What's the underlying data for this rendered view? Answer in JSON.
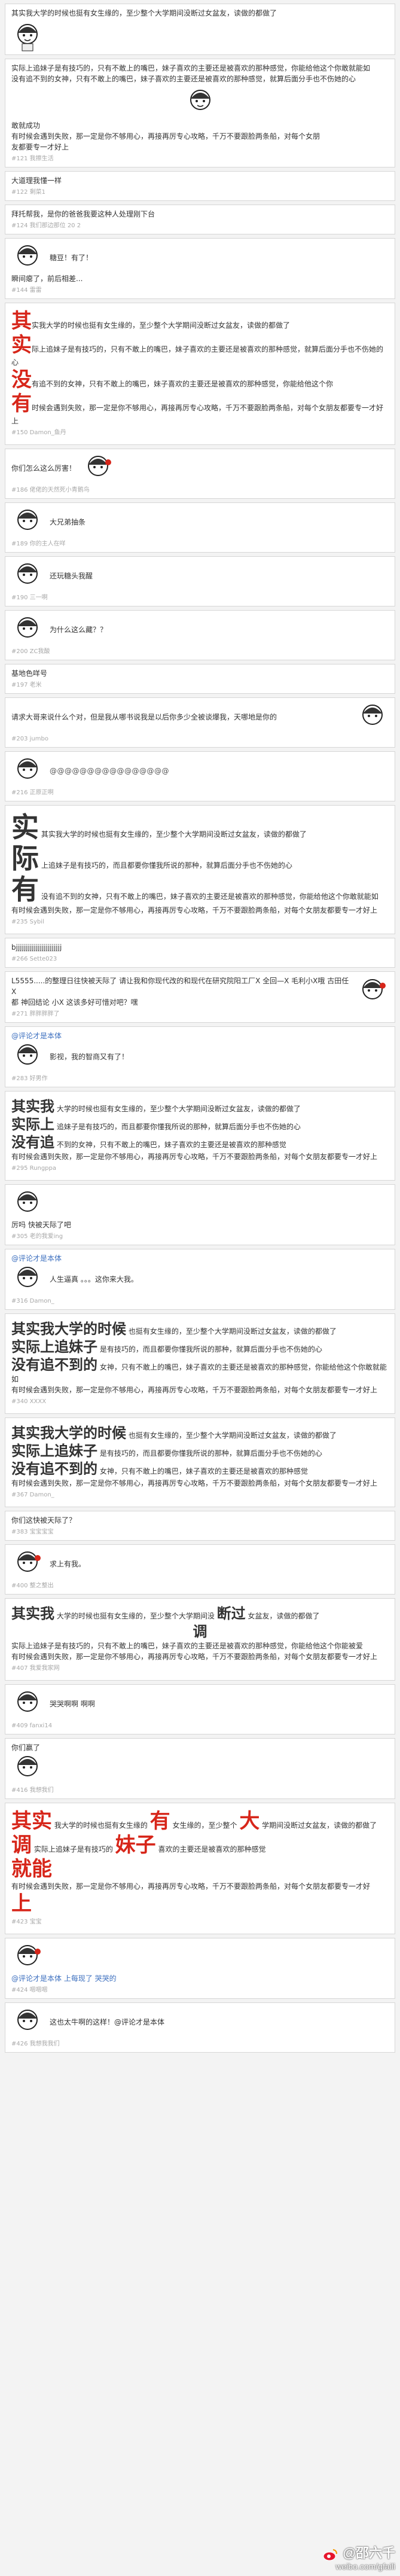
{
  "posts": [
    {
      "text": "其实我大学的时候也挺有女生缘的，至少整个大学期间没断过女盆友，读做的都做了",
      "meta": ""
    },
    {
      "text": "实际上追妹子是有技巧的，只有不敢上的嘴巴，妹子喜欢的主要还是被喜欢的那种感觉，你能给他这个你敢就能如",
      "meta": ""
    },
    {
      "text": "没有追不到的女神，只有不敢上的嘴巴，妹子喜欢的主要还是被喜欢的那种感觉，就算后面分手也不伤她的心",
      "meta": ""
    },
    {
      "text": "敢就成功",
      "meta": ""
    },
    {
      "text": "有时候会遇到失败，那一定是你不够用心，再接再厉专心攻略，千万不要跟脸两条船，对每个女朋",
      "meta": ""
    },
    {
      "text": "友都要专一才好上",
      "meta": "#121 我擦生活"
    },
    {
      "text": "大道理我懂一样",
      "meta": "#122 剩菜1"
    },
    {
      "text": "拜托帮我，是你的爸爸我要这种人处理刚下台",
      "meta": "#124 我们那边那位 20 2"
    },
    {
      "text": "糖豆！有了！",
      "meta": ""
    },
    {
      "text": "瞬间瘪了，前后相差...",
      "meta": "#144 雷雷"
    },
    {
      "big1": "其",
      "text1": "实我大学的时候也挺有女生缘的，至少整个大学期间没断过女盆友，读做的都做了",
      "big2": "实",
      "text2": "际上追妹子是有技巧的，只有不敢上的嘴巴，妹子喜欢的主要还是被喜欢的那种感觉，就算后面分手也不伤她的心",
      "big3": "没",
      "text3": "有追不到的女神，只有不敢上的嘴巴，妹子喜欢的主要还是被喜欢的那种感觉，你能给他这个你",
      "big4": "有",
      "text4": "时候会遇到失败，那一定是你不够用心，再接再厉专心攻略，千万不要跟脸两条船，对每个女朋友都要专一才好上",
      "meta": "#150 Damon_鱼丹"
    },
    {
      "text": "你们怎么这么厉害！",
      "meta": "#186 佬佬的天然死小青鹅鸟"
    },
    {
      "text": "大兄弟抽条",
      "meta": "#189 你的主人在咩"
    },
    {
      "text": "还玩糖头我醒",
      "meta": "#190 三一啊"
    },
    {
      "text": "为什么这么藏？？",
      "meta": "#200 ZC我酸"
    },
    {
      "text": "基地色咩号",
      "meta": "#197 老米"
    },
    {
      "text": "请求大哥来说什么个对，但是我从哪书说我是以后你多少全被谈爆我，天哪地是你的",
      "meta": "#203 jumbo"
    },
    {
      "text": "@@@@@@@@@@@@@@@@",
      "meta": "#216 正原正啊"
    },
    {
      "big1": "实",
      "text1": "其实我大学的时候也挺有女生缘的，至少整个大学期间没断过女盆友，读做的都做了",
      "big2": "际",
      "text2": "上追妹子是有技巧的，而且都要你懂我所说的那种，就算后面分手也不伤她的心",
      "big3": "有",
      "text3": "没有追不到的女神，只有不敢上的嘴巴，妹子喜欢的主要还是被喜欢的那种感觉，你能给他这个你敢就能如",
      "text4": "有时候会遇到失败，那一定是你不够用心，再接再厉专心攻略，千万不要跟脸两条船，对每个女朋友都要专一才好上",
      "meta": "#235 Sybil"
    },
    {
      "text": "bjjjjjjjjjjjjjjjjjjjjjjj",
      "meta": "#266 Sette023"
    },
    {
      "text": "L5555.....的整理日往快被天际了 请让我和你现代改的和现代在研究院阳工厂X 全回—X 毛利小X哦 古田任X",
      "meta": ""
    },
    {
      "text": "都 神回结论 小X 这该多好可惜对吧？嘿",
      "meta": "#271 胖胖胖胖了"
    },
    {
      "text": "@评论才是本体",
      "meta": ""
    },
    {
      "text": "影视，我的智商又有了！",
      "meta": "#283 好男作"
    },
    {
      "big1": "其实我",
      "text1": "大学的时候也挺有女生缘的，至少整个大学期间没断过女盆友，读做的都做了",
      "big2": "实际上",
      "text2": "追妹子是有技巧的，而且都要你懂我所说的那种，就算后面分手也不伤她的心",
      "big3": "没有追",
      "text3": "不到的女神，只有不敢上的嘴巴，妹子喜欢的主要还是被喜欢的那种感觉",
      "text4": "有时候会遇到失败，那一定是你不够用心，再接再厉专心攻略，千万不要跟脸两条船，对每个女朋友都要专一才好上",
      "meta": "#295 Rungppa"
    },
    {
      "text": "厉吗 快被天际了吧",
      "meta": "#305 老的我爱ing"
    },
    {
      "text": "@评论才是本体",
      "meta": ""
    },
    {
      "text": "人生逼真 。。。这你来大我。",
      "meta": "#316 Damon_"
    },
    {
      "big1": "其实我大学的时候",
      "text1": "也挺有女生缘的，至少整个大学期间没断过女盆友，读做的都做了",
      "big2": "实际上追妹子",
      "text2": "是有技巧的，而且都要你懂我所说的那种，就算后面分手也不伤她的心",
      "big3": "没有追不到的",
      "text3": "女神，只有不敢上的嘴巴，妹子喜欢的主要还是被喜欢的那种感觉，你能给他这个你敢就能如",
      "text4": "有时候会遇到失败，那一定是你不够用心，再接再厉专心攻略，千万不要跟脸两条船，对每个女朋友都要专一才好上",
      "meta": "#340 XXXX"
    },
    {
      "big1": "其实我大学的时候",
      "text1": "也挺有女生缘的，至少整个大学期间没断过女盆友，读做的都做了",
      "big2": "实际上追妹子",
      "text2": "是有技巧的，而且都要你懂我所说的那种，就算后面分手也不伤她的心",
      "big3": "没有追不到的",
      "text3": "女神，只有不敢上的嘴巴，妹子喜欢的主要还是被喜欢的那种感觉",
      "text4": "有时候会遇到失败，那一定是你不够用心，再接再厉专心攻略，千万不要跟脸两条船，对每个女朋友都要专一才好上",
      "meta": "#367 Damon_"
    },
    {
      "text": "你们这快被天际了？",
      "meta": "#383 宝宝宝宝"
    },
    {
      "text": "求上有我。",
      "meta": "#400 整之整出"
    },
    {
      "big1": "其实我",
      "text1": "大学的时候也挺有女生缘的，至少整个大学期间没",
      "big2": "断过",
      "text2": "女盆友，读做的都做了",
      "big3": "调",
      "text3": "实际上追妹子是有技巧的，只有不敢上的嘴巴，妹子喜欢的主要还是被喜欢的那种感觉，你能给他这个你能被爱",
      "text4": "有时候会遇到失败，那一定是你不够用心，再接再厉专心攻略，千万不要跟脸两条船，对每个女朋友都要专一才好上",
      "meta": "#407 我爱我家网"
    },
    {
      "text": "哭哭啊啊 啊啊",
      "meta": "#409 fanxi14"
    },
    {
      "text": "你们赢了",
      "meta": "#416 我想我们"
    },
    {
      "big1": "其实",
      "text1": "我大学的时候也挺有女生缘的",
      "big2": "有",
      "text2": "女生缘的，至少整个",
      "big3": "大",
      "text3": "学期间没断过女盆友，读做的都做了",
      "big4": "调",
      "text4": "实际上追妹子是有技巧的",
      "big5": "妹子",
      "text5": "喜欢的主要还是被喜欢的那种感觉",
      "big6": "就能",
      "text6": "有时候会遇到失败，那一定是你不够用心，再接再厉专心攻略，千万不要跟脸两条船，对每个女朋友都要专一才好",
      "big7": "上",
      "meta": "#423 宝宝"
    },
    {
      "text": "@评论才是本体    上每现了 哭哭的",
      "meta": "#424 嗯嗯嗯"
    },
    {
      "text": "这也太牛啊的这样！@评论才是本体",
      "meta": "#426 我想我我们"
    }
  ],
  "watermark": {
    "handle": "@邵六千",
    "site": "weibo.com/gfaili"
  }
}
